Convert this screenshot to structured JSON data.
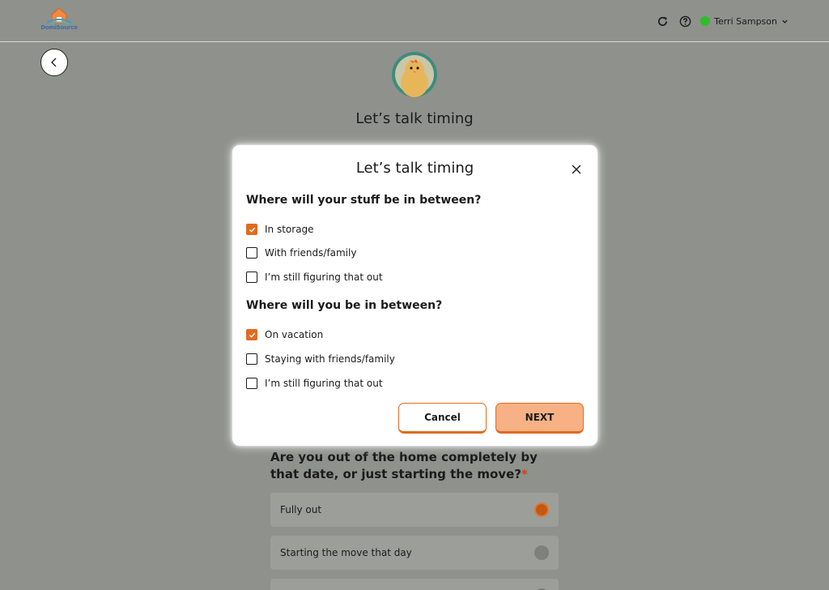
{
  "header": {
    "logo_text": "DomiSource",
    "user_name": "Terri Sampson",
    "refresh_icon": "refresh-icon",
    "help_icon": "help-icon"
  },
  "page": {
    "title": "Let’s talk timing",
    "question": "Are you out of the home completely by that date, or just starting the move?",
    "required_mark": "*",
    "options": [
      {
        "label": "Fully out",
        "selected": true
      },
      {
        "label": "Starting the move that day",
        "selected": false
      },
      {
        "label": "",
        "selected": false
      }
    ]
  },
  "modal": {
    "title": "Let’s talk timing",
    "section1": {
      "title": "Where will your stuff be in between?",
      "options": [
        {
          "label": "In storage",
          "checked": true
        },
        {
          "label": "With friends/family",
          "checked": false
        },
        {
          "label": "I’m still figuring that out",
          "checked": false
        }
      ]
    },
    "section2": {
      "title": "Where will you be in between?",
      "options": [
        {
          "label": "On vacation",
          "checked": true
        },
        {
          "label": "Staying with friends/family",
          "checked": false
        },
        {
          "label": "I’m still figuring that out",
          "checked": false
        }
      ]
    },
    "cancel_label": "Cancel",
    "next_label": "NEXT"
  },
  "colors": {
    "accent": "#e26a1e",
    "next_button": "#f7b184",
    "status_online": "#2fbd2a"
  }
}
